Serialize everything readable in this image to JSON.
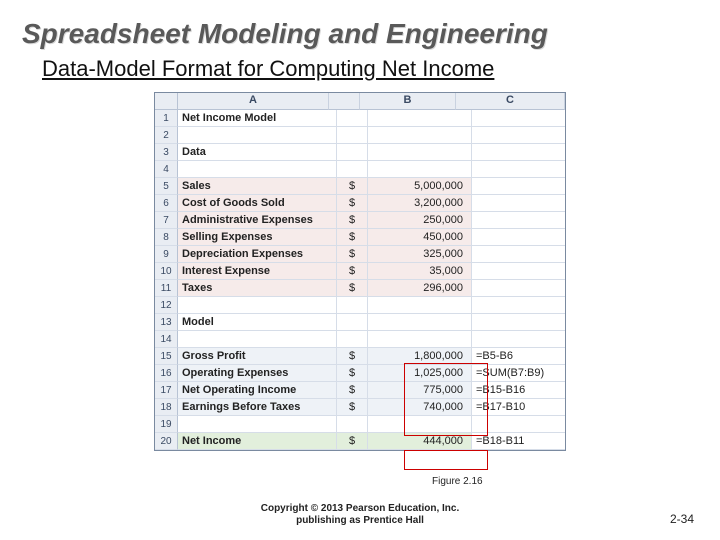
{
  "title": "Spreadsheet Modeling and Engineering",
  "subtitle": "Data-Model Format for Computing Net Income",
  "col_headers": {
    "A": "A",
    "B": "B",
    "C": "C"
  },
  "rows": [
    {
      "n": "1",
      "A": "Net Income Model",
      "bold": true,
      "blank": false
    },
    {
      "n": "2",
      "blank": true
    },
    {
      "n": "3",
      "A": "Data",
      "bold": true
    },
    {
      "n": "4",
      "blank": true
    },
    {
      "n": "5",
      "A": "Sales",
      "bold": true,
      "B": "$",
      "C": "5,000,000",
      "pink": true
    },
    {
      "n": "6",
      "A": "Cost of Goods Sold",
      "bold": true,
      "B": "$",
      "C": "3,200,000",
      "pink": true
    },
    {
      "n": "7",
      "A": "Administrative Expenses",
      "bold": true,
      "B": "$",
      "C": "250,000",
      "pink": true
    },
    {
      "n": "8",
      "A": "Selling Expenses",
      "bold": true,
      "B": "$",
      "C": "450,000",
      "pink": true
    },
    {
      "n": "9",
      "A": "Depreciation Expenses",
      "bold": true,
      "B": "$",
      "C": "325,000",
      "pink": true
    },
    {
      "n": "10",
      "A": "Interest Expense",
      "bold": true,
      "B": "$",
      "C": "35,000",
      "pink": true
    },
    {
      "n": "11",
      "A": "Taxes",
      "bold": true,
      "B": "$",
      "C": "296,000",
      "pink": true
    },
    {
      "n": "12",
      "blank": true
    },
    {
      "n": "13",
      "A": "Model",
      "bold": true
    },
    {
      "n": "14",
      "blank": true
    },
    {
      "n": "15",
      "A": "Gross Profit",
      "bold": true,
      "B": "$",
      "C": "1,800,000",
      "D": "=B5-B6",
      "blue": true
    },
    {
      "n": "16",
      "A": "Operating Expenses",
      "bold": true,
      "B": "$",
      "C": "1,025,000",
      "D": "=SUM(B7:B9)",
      "blue": true
    },
    {
      "n": "17",
      "A": "Net Operating Income",
      "bold": true,
      "B": "$",
      "C": "775,000",
      "D": "=B15-B16",
      "blue": true
    },
    {
      "n": "18",
      "A": "Earnings Before Taxes",
      "bold": true,
      "B": "$",
      "C": "740,000",
      "D": "=B17-B10",
      "blue": true
    },
    {
      "n": "19",
      "blank": true
    },
    {
      "n": "20",
      "A": "Net Income",
      "bold": true,
      "B": "$",
      "C": "444,000",
      "D": "=B18-B11",
      "green": true
    }
  ],
  "figure_caption": "Figure 2.16",
  "copyright_line1": "Copyright © 2013 Pearson Education, Inc.",
  "copyright_line2": "publishing as Prentice Hall",
  "page_number": "2-34"
}
